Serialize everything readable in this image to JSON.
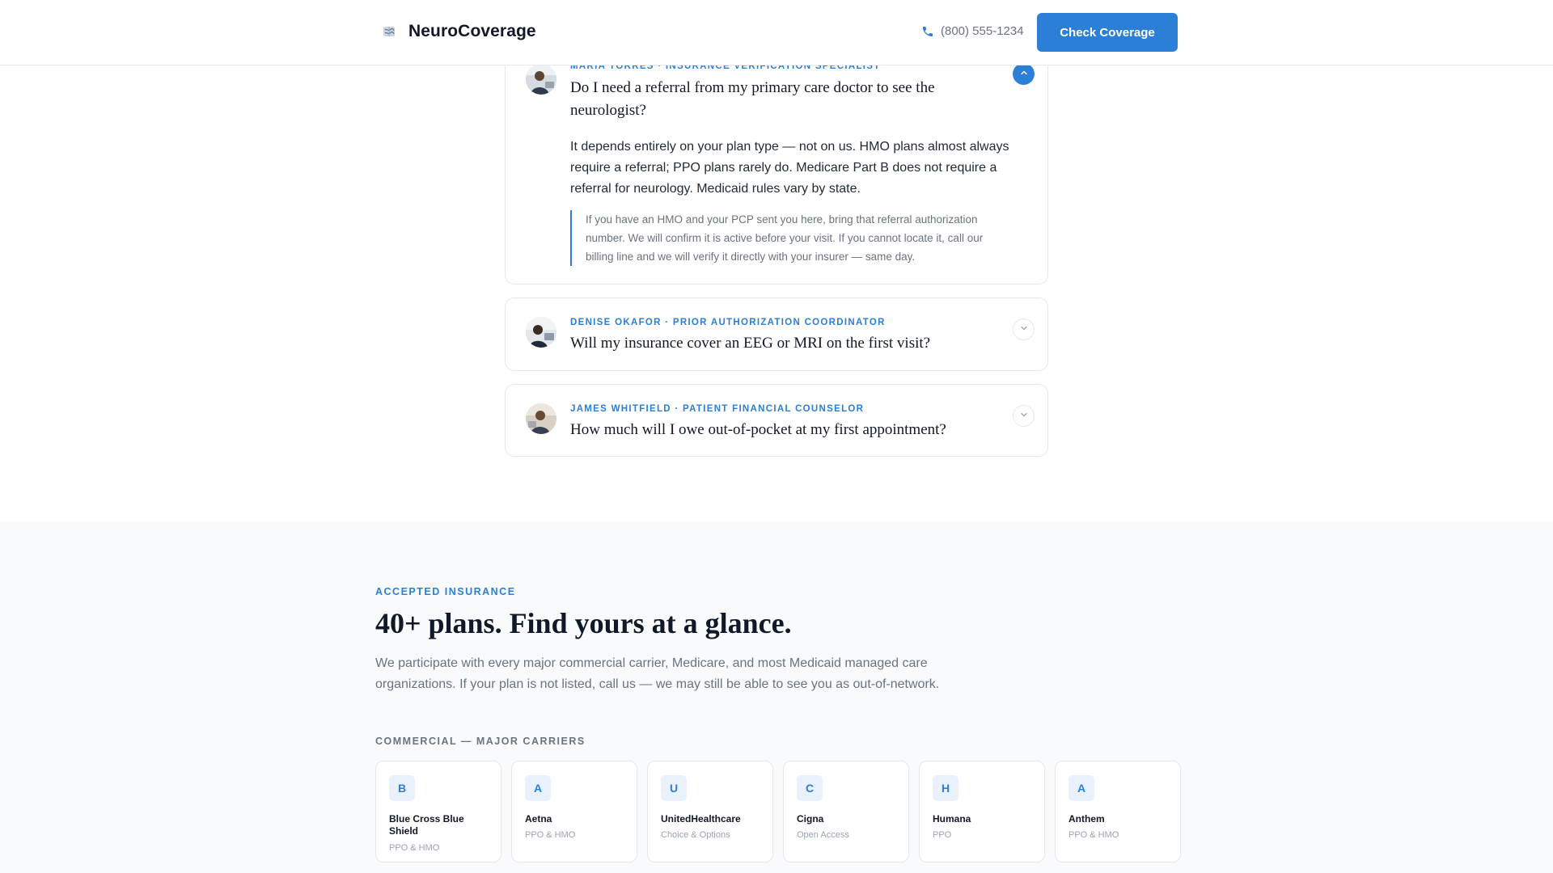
{
  "header": {
    "brand": "NeuroCoverage",
    "brand_icon": "brain-icon",
    "phone": "(800) 555-1234",
    "phone_icon": "phone-icon",
    "cta_label": "Check Coverage"
  },
  "faq": {
    "items": [
      {
        "role": "MARIA TORRES · INSURANCE VERIFICATION SPECIALIST",
        "question": "Do I need a referral from my primary care doctor to see the neurologist?",
        "expanded": true,
        "answer": "It depends entirely on your plan type — not on us. HMO plans almost always require a referral; PPO plans rarely do. Medicare Part B does not require a referral for neurology. Medicaid rules vary by state.",
        "note": "If you have an HMO and your PCP sent you here, bring that referral authorization number. We will confirm it is active before your visit. If you cannot locate it, call our billing line and we will verify it directly with your insurer — same day."
      },
      {
        "role": "DENISE OKAFOR · PRIOR AUTHORIZATION COORDINATOR",
        "question": "Will my insurance cover an EEG or MRI on the first visit?",
        "expanded": false
      },
      {
        "role": "JAMES WHITFIELD · PATIENT FINANCIAL COUNSELOR",
        "question": "How much will I owe out-of-pocket at my first appointment?",
        "expanded": false
      }
    ]
  },
  "insurance": {
    "eyebrow": "ACCEPTED INSURANCE",
    "title": "40+ plans. Find yours at a glance.",
    "description": "We participate with every major commercial carrier, Medicare, and most Medicaid managed care organizations. If your plan is not listed, call us — we may still be able to see you as out-of-network.",
    "subhead": "COMMERCIAL — MAJOR CARRIERS",
    "carriers": [
      {
        "initial": "B",
        "name": "Blue Cross Blue Shield",
        "type": "PPO & HMO"
      },
      {
        "initial": "A",
        "name": "Aetna",
        "type": "PPO & HMO"
      },
      {
        "initial": "U",
        "name": "UnitedHealthcare",
        "type": "Choice & Options"
      },
      {
        "initial": "C",
        "name": "Cigna",
        "type": "Open Access"
      },
      {
        "initial": "H",
        "name": "Humana",
        "type": "PPO"
      },
      {
        "initial": "A",
        "name": "Anthem",
        "type": "PPO & HMO"
      }
    ]
  },
  "colors": {
    "accent": "#2b7fd6",
    "section_bg": "#f8fafc",
    "border": "#e5e7eb"
  }
}
